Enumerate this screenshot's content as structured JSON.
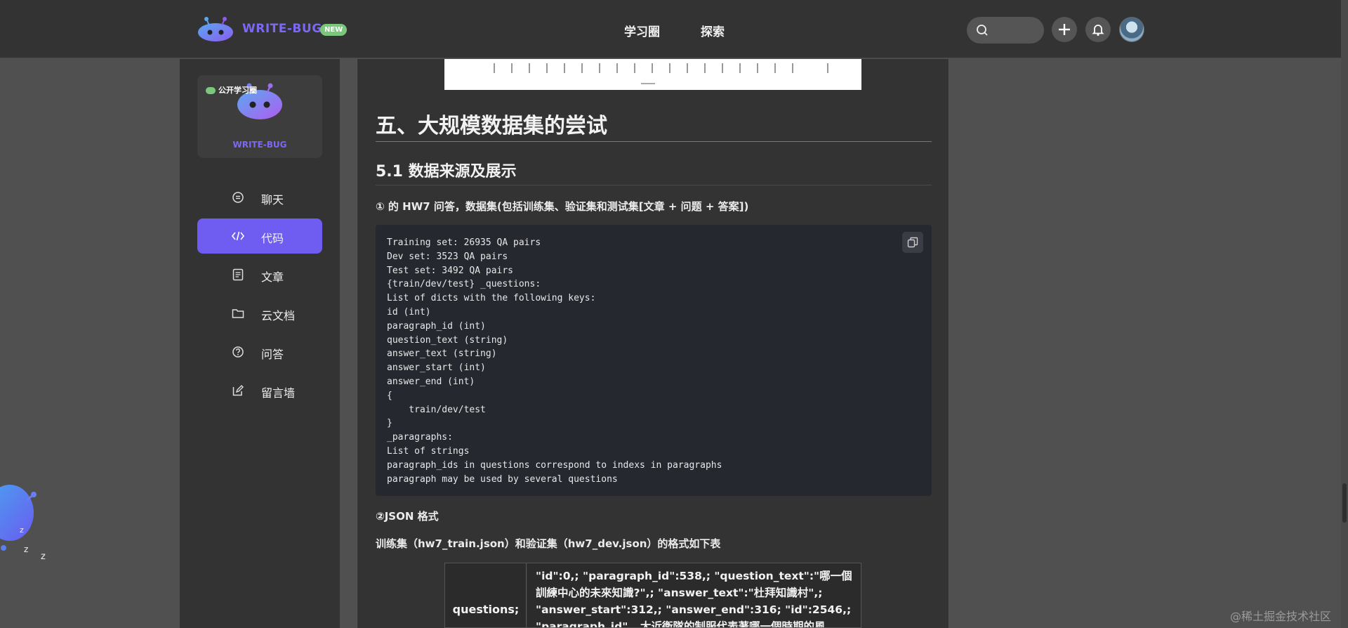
{
  "header": {
    "brand": "WRITE-BUG",
    "new_badge": "NEW",
    "nav": [
      "学习圈",
      "探索"
    ]
  },
  "sidebar": {
    "card_badge": "公开学习圈",
    "card_brand": "WRITE-BUG",
    "items": [
      {
        "label": "聊天",
        "icon": "chat-icon",
        "active": false
      },
      {
        "label": "代码",
        "icon": "code-icon",
        "active": true
      },
      {
        "label": "文章",
        "icon": "article-icon",
        "active": false
      },
      {
        "label": "云文档",
        "icon": "folder-icon",
        "active": false
      },
      {
        "label": "问答",
        "icon": "question-icon",
        "active": false
      },
      {
        "label": "留言墙",
        "icon": "edit-icon",
        "active": false
      }
    ]
  },
  "article": {
    "h1": "五、大规模数据集的尝试",
    "h2": "5.1 数据来源及展示",
    "p1": "① 的 HW7 问答，数据集(包括训练集、验证集和测试集[文章 + 问题 + 答案])",
    "code": "Training set: 26935 QA pairs\nDev set: 3523 QA pairs\nTest set: 3492 QA pairs\n{train/dev/test} _questions:\nList of dicts with the following keys:\nid (int)\nparagraph_id (int)\nquestion_text (string)\nanswer_text (string)\nanswer_start (int)\nanswer_end (int)\n{\n    train/dev/test\n}\n_paragraphs:\nList of strings\nparagraph_ids in questions correspond to indexs in paragraphs\nparagraph may be used by several questions",
    "p2": "②JSON 格式",
    "p3": "训练集（hw7_train.json）和验证集（hw7_dev.json）的格式如下表",
    "table": {
      "key": "questions;",
      "value": "\"id\":0,; \"paragraph_id\":538,; \"question_text\":\"哪一個訓練中心的未來知識?\",; \"answer_text\":\"杜拜知識村\",; \"answer_start\":312,; \"answer_end\":316; \"id\":2546,; \"paragraph_id\"...大近衛隊的制服代表著哪一個時期的風格?\",; \"answer_text\":\"文藝"
    }
  },
  "watermark": "@稀土掘金技术社区",
  "colors": {
    "accent": "#6f5cf0",
    "badge": "#7bc77b",
    "panel": "#333333",
    "code_bg": "#262830"
  }
}
